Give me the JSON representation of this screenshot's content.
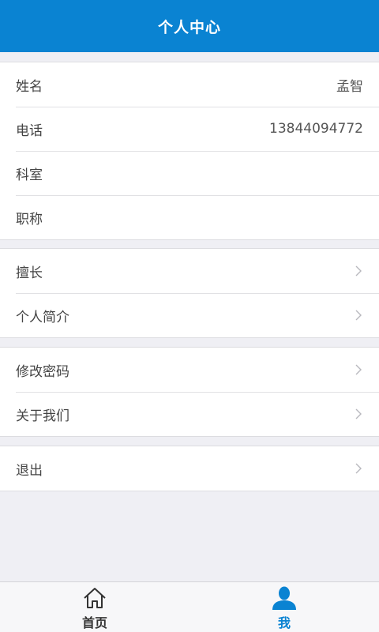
{
  "header": {
    "title": "个人中心"
  },
  "profile": {
    "name_label": "姓名",
    "name_value": "孟智",
    "phone_label": "电话",
    "phone_value": "13844094772",
    "dept_label": "科室",
    "dept_value": "",
    "title_label": "职称",
    "title_value": ""
  },
  "details": {
    "specialty_label": "擅长",
    "intro_label": "个人简介"
  },
  "settings": {
    "password_label": "修改密码",
    "about_label": "关于我们"
  },
  "session": {
    "logout_label": "退出"
  },
  "tabbar": {
    "home_label": "首页",
    "me_label": "我",
    "home_icon": "home-icon",
    "me_icon": "user-icon",
    "active_color": "#0a83d2"
  },
  "colors": {
    "accent": "#0a83d2"
  }
}
